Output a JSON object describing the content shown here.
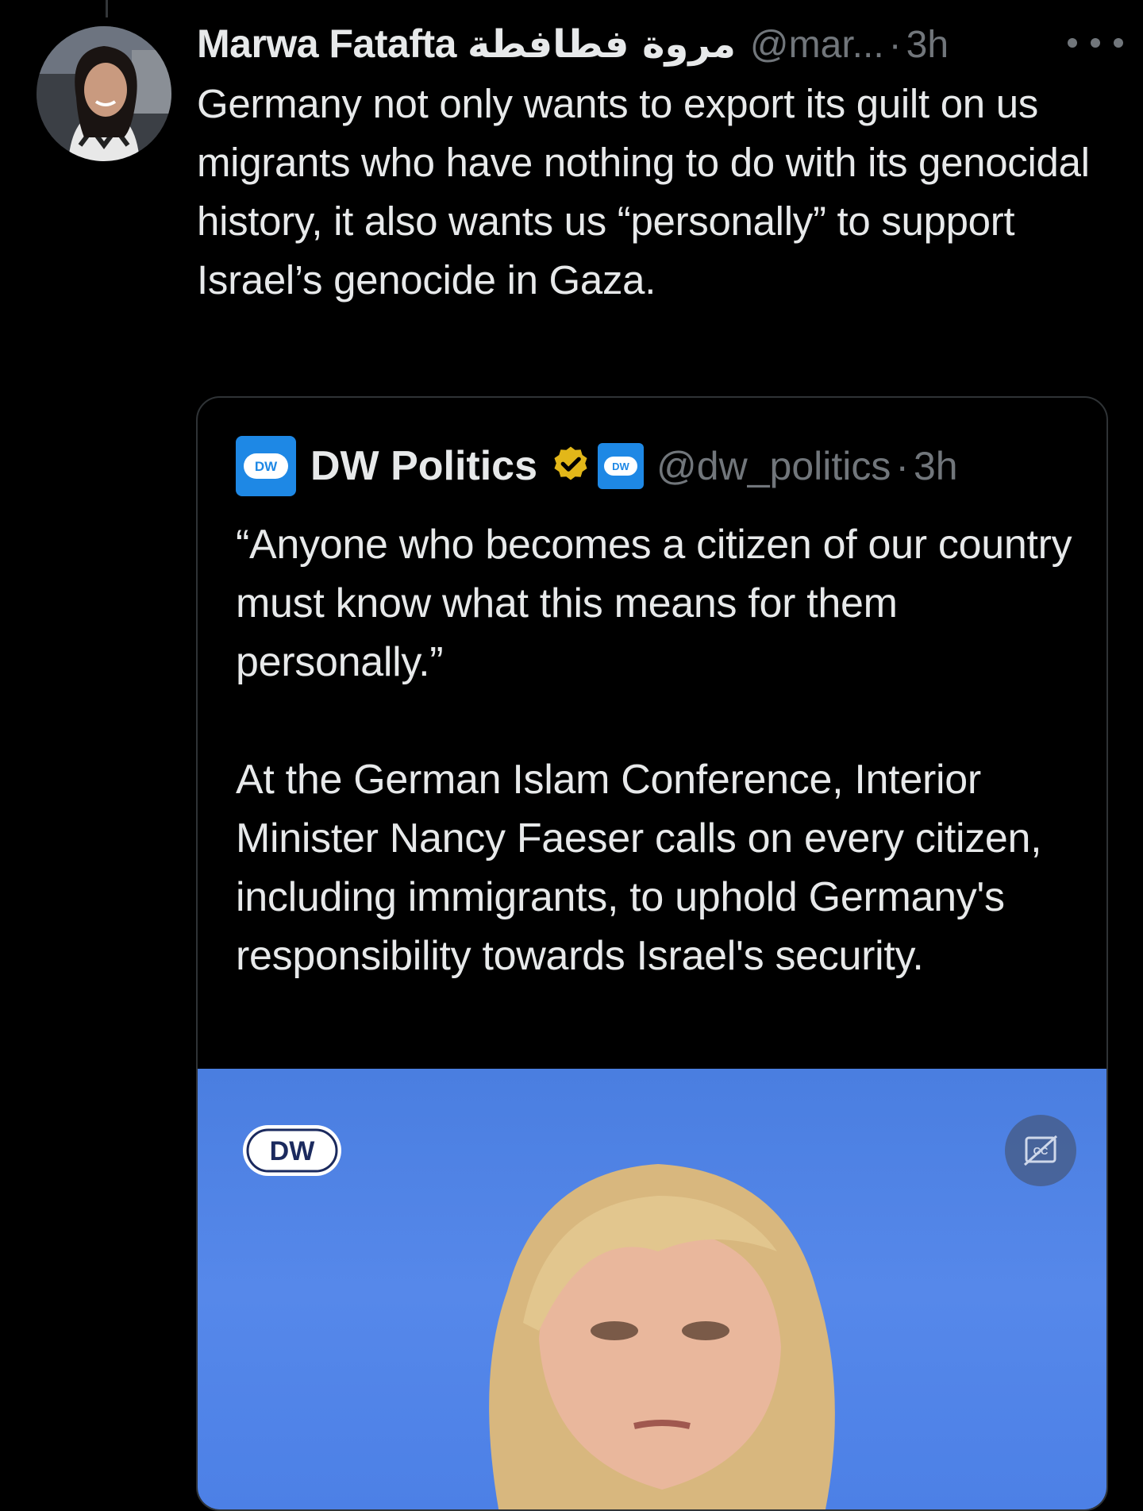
{
  "tweet": {
    "author_name": "Marwa Fatafta",
    "author_name_arabic": "مروة فطافطة",
    "handle": "@mar...",
    "separator": "·",
    "time": "3h",
    "text": "Germany not only wants to export its guilt on us migrants who have nothing to do with its genocidal history, it also wants us “personally” to support Israel’s genocide in Gaza."
  },
  "quoted_tweet": {
    "author_name": "DW Politics",
    "handle": "@dw_politics",
    "separator": "·",
    "time": "3h",
    "logo_text": "DW",
    "paragraph_1": "“Anyone who becomes a citizen of our country must know what this means for them personally.”",
    "paragraph_2": "At the German Islam Conference, Interior Minister Nancy Faeser calls on every citizen, including immigrants, to uphold Germany's responsibility towards Israel's security.",
    "media": {
      "watermark_text": "DW",
      "caption_icon": "closed-captions-icon"
    }
  },
  "icons": {
    "more": "more-horizontal-icon",
    "verified": "verified-badge-icon"
  },
  "colors": {
    "background": "#000000",
    "text_primary": "#e7e9ea",
    "text_secondary": "#71767b",
    "border": "#2f3336",
    "dw_blue": "#1e88e5",
    "verified_gold": "#e2b719",
    "media_blue": "#5688ea"
  }
}
